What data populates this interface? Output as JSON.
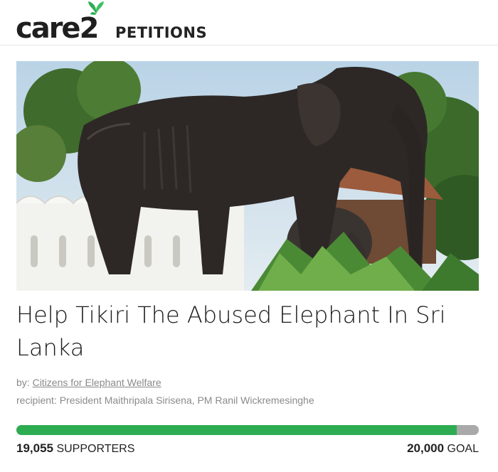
{
  "header": {
    "logo_word": "care",
    "logo_number": "2",
    "section": "PETITIONS",
    "brand_color": "#2eac52"
  },
  "hero_image": {
    "alt": "emaciated elephant",
    "icon": "elephant-photo"
  },
  "petition": {
    "title": "Help Tikiri The Abused Elephant In Sri Lanka",
    "by_label": "by:",
    "author": "Citizens for Elephant Welfare",
    "recipient": "recipient: President Maithripala Sirisena, PM Ranil Wickremesinghe"
  },
  "progress": {
    "supporters_value": "19,055",
    "supporters_label": "SUPPORTERS",
    "goal_value": "20,000",
    "goal_label": "GOAL",
    "fraction": 0.95275,
    "fill_color": "#2eac52",
    "track_color": "#a9a9a9"
  }
}
